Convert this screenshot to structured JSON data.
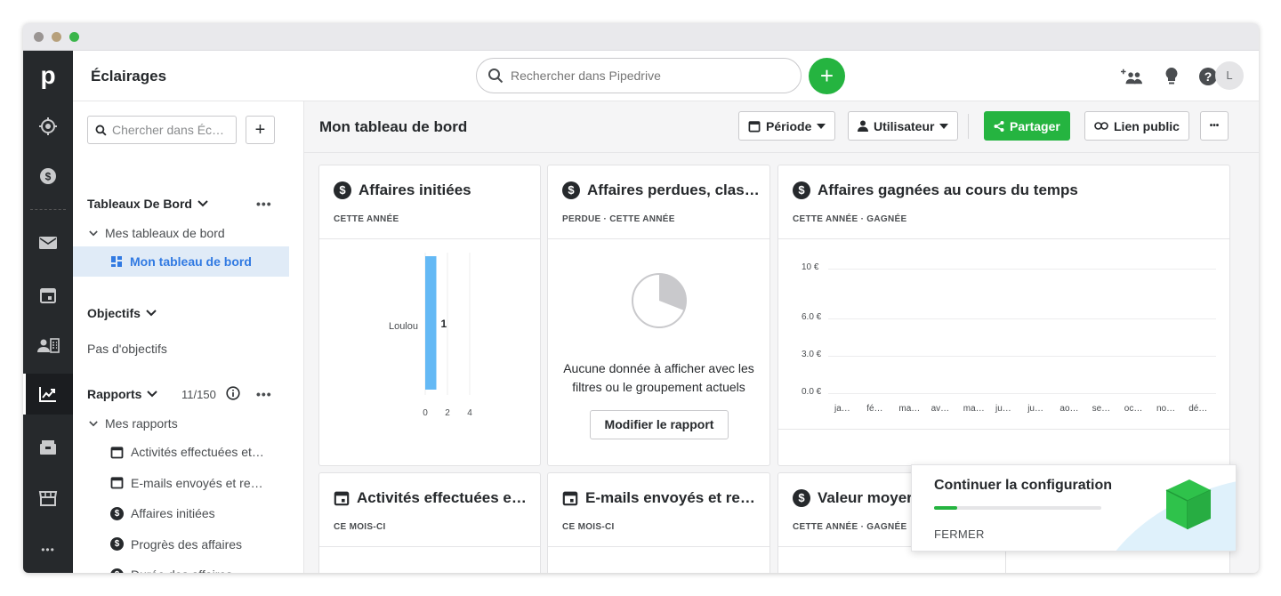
{
  "window": {
    "dot_colors": [
      "#9a9593",
      "#b7a07b",
      "#3ab54a"
    ]
  },
  "app": {
    "title": "Éclairages",
    "logo": "p",
    "avatar_initial": "L",
    "accent": "#25b440",
    "link_color": "#317ae2"
  },
  "search": {
    "placeholder": "Rechercher dans Pipedrive"
  },
  "nav": {
    "items": [
      "target-icon",
      "dollar-icon",
      "mail-icon",
      "calendar-icon",
      "contacts-icon",
      "insights-icon",
      "products-icon",
      "marketplace-icon",
      "more-icon"
    ],
    "more": "•••"
  },
  "sidebar": {
    "search_placeholder": "Chercher dans Éc…",
    "dashboards_title": "Tableaux De Bord",
    "dashboards_more": "•••",
    "my_dashboards": "Mes tableaux de bord",
    "selected_dashboard": "Mon tableau de bord",
    "goals_title": "Objectifs",
    "no_goals": "Pas d'objectifs",
    "reports_title": "Rapports",
    "reports_count": "11/150",
    "reports_more": "•••",
    "my_reports": "Mes rapports",
    "reports": [
      {
        "icon": "calendar-icon",
        "label": "Activités effectuées et…"
      },
      {
        "icon": "calendar-icon",
        "label": "E-mails envoyés et re…"
      },
      {
        "icon": "dollar-icon",
        "label": "Affaires initiées"
      },
      {
        "icon": "dollar-icon",
        "label": "Progrès des affaires"
      },
      {
        "icon": "dollar-icon",
        "label": "Durée des affaires"
      }
    ]
  },
  "dashboard": {
    "title": "Mon tableau de bord",
    "period_label": "Période",
    "user_label": "Utilisateur",
    "share_label": "Partager",
    "public_link_label": "Lien public",
    "more_label": "•••"
  },
  "cards": {
    "c1": {
      "title": "Affaires initiées",
      "subtitle": "CETTE ANNÉE",
      "bar_label": "Loulou",
      "bar_value": "1",
      "ticks": [
        "0",
        "2",
        "4"
      ]
    },
    "c2": {
      "title": "Affaires perdues, clas…",
      "subtitle": "PERDUE · CETTE ANNÉE",
      "empty_line1": "Aucune donnée à afficher avec les",
      "empty_line2": "filtres ou le groupement actuels",
      "button": "Modifier le rapport"
    },
    "c3": {
      "title": "Affaires gagnées au cours du temps",
      "subtitle": "CETTE ANNÉE · GAGNÉE",
      "y_ticks": [
        "10 €",
        "6.0 €",
        "3.0 €",
        "0.0 €"
      ],
      "months": [
        "ja…",
        "fé…",
        "ma…",
        "av…",
        "ma…",
        "ju…",
        "ju…",
        "ao…",
        "se…",
        "oc…",
        "no…",
        "dé…"
      ]
    },
    "c4": {
      "title": "Activités effectuées e…",
      "subtitle": "CE MOIS-CI"
    },
    "c5": {
      "title": "E-mails envoyés et re…",
      "subtitle": "CE MOIS-CI"
    },
    "c6": {
      "title": "Valeur moyer",
      "subtitle": "CETTE ANNÉE · GAGNÉE"
    }
  },
  "chart_data": {
    "type": "bar",
    "categories": [
      "Loulou"
    ],
    "values": [
      1
    ],
    "xlabel": "",
    "ylabel": "",
    "xlim": [
      0,
      4
    ]
  },
  "popup": {
    "title": "Continuer la configuration",
    "progress": 0.14,
    "close": "FERMER"
  }
}
